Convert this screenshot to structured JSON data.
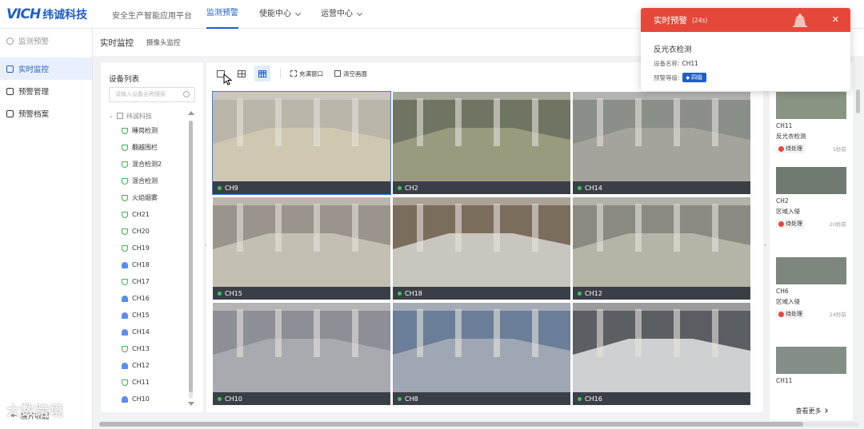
{
  "header": {
    "logo_latin": "VICH",
    "logo_cn": "纬诚科技",
    "platform": "安全生产智能应用平台",
    "nav": [
      {
        "label": "监测预警",
        "active": true
      },
      {
        "label": "使能中心",
        "dropdown": true
      },
      {
        "label": "运营中心",
        "dropdown": true
      }
    ]
  },
  "sidebar": {
    "items": [
      {
        "label": "监测预警",
        "icon": "settings-icon"
      },
      {
        "label": "实时监控",
        "icon": "monitor-icon",
        "active": true
      },
      {
        "label": "预警管理",
        "icon": "alert-manage-icon"
      },
      {
        "label": "预警档案",
        "icon": "archive-icon"
      }
    ],
    "collapse_label": "展开收起"
  },
  "tabs": [
    {
      "label": "实时监控"
    },
    {
      "label": "摄像头监控"
    }
  ],
  "device_list": {
    "title": "设备列表",
    "search_placeholder": "请输入设备名称搜索",
    "root": "纬诚科技",
    "items": [
      {
        "label": "睡岗检测",
        "icon": "green"
      },
      {
        "label": "翻越围栏",
        "icon": "green"
      },
      {
        "label": "混合检测2",
        "icon": "green"
      },
      {
        "label": "混合检测",
        "icon": "green"
      },
      {
        "label": "火焰烟雾",
        "icon": "green"
      },
      {
        "label": "CH21",
        "icon": "green"
      },
      {
        "label": "CH20",
        "icon": "green"
      },
      {
        "label": "CH19",
        "icon": "green"
      },
      {
        "label": "CH18",
        "icon": "blue"
      },
      {
        "label": "CH17",
        "icon": "green"
      },
      {
        "label": "CH16",
        "icon": "blue"
      },
      {
        "label": "CH15",
        "icon": "blue"
      },
      {
        "label": "CH14",
        "icon": "blue"
      },
      {
        "label": "CH13",
        "icon": "green"
      },
      {
        "label": "CH12",
        "icon": "blue"
      },
      {
        "label": "CH11",
        "icon": "green"
      },
      {
        "label": "CH10",
        "icon": "blue"
      }
    ]
  },
  "toolbar": {
    "fill_window": "充满窗口",
    "clear_screen": "清空画面"
  },
  "cameras": [
    {
      "label": "CH9",
      "scene": "#b9b5a8",
      "floor": "#cfc7b0"
    },
    {
      "label": "CH2",
      "scene": "#6f7463",
      "floor": "#9a9a7e"
    },
    {
      "label": "CH14",
      "scene": "#8b8f8a",
      "floor": "#a5a39b"
    },
    {
      "label": "CH15",
      "scene": "#9a948a",
      "floor": "#c4bfb3"
    },
    {
      "label": "CH18",
      "scene": "#7a6d5c",
      "floor": "#c9c6c0"
    },
    {
      "label": "CH12",
      "scene": "#8a8a80",
      "floor": "#b6b3a7"
    },
    {
      "label": "CH10",
      "scene": "#8c8f96",
      "floor": "#a9aab0"
    },
    {
      "label": "CH8",
      "scene": "#6a7d99",
      "floor": "#9fa7b4"
    },
    {
      "label": "CH16",
      "scene": "#5b5e63",
      "floor": "#cfd0d2"
    }
  ],
  "right_panel": {
    "title": "理",
    "alarms": [
      {
        "cam": "CH11",
        "type": "反光衣检测",
        "status": "待处理",
        "time": "1秒前"
      },
      {
        "cam": "CH2",
        "type": "区域入侵",
        "status": "待处理",
        "time": "20秒前"
      },
      {
        "cam": "CH6",
        "type": "区域入侵",
        "status": "待处理",
        "time": "24秒前"
      },
      {
        "cam": "CH11",
        "type": "",
        "status": "",
        "time": ""
      }
    ],
    "view_more": "查看更多"
  },
  "popup": {
    "title": "实时预警",
    "count": "(24s)",
    "event": "反光衣检测",
    "device_label": "设备名称:",
    "device_value": "CH11",
    "level_label": "预警等级:",
    "level_value": "四级",
    "header_color": "#e5483a"
  },
  "watermark": "大数跨境",
  "colors": {
    "brand": "#1e5fc7",
    "alert": "#e5483a",
    "live": "#3bc45a"
  }
}
